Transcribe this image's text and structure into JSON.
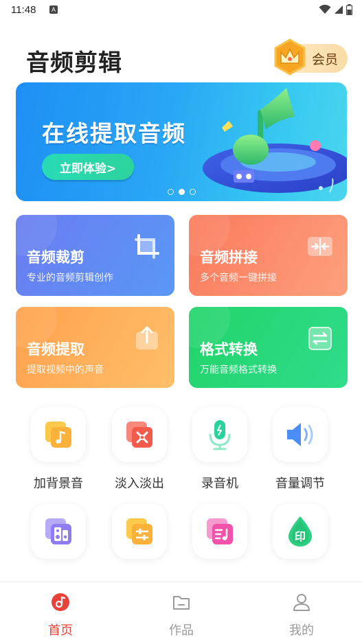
{
  "status_bar": {
    "time": "11:48",
    "notice_letter": "A"
  },
  "header": {
    "title": "音频剪辑",
    "vip_label": "会员"
  },
  "banner": {
    "title": "在线提取音频",
    "cta": "立即体验>",
    "active_dot": 1,
    "dot_count": 3
  },
  "cards": [
    {
      "title": "音频裁剪",
      "subtitle": "专业的音频剪辑创作",
      "icon": "crop-icon"
    },
    {
      "title": "音频拼接",
      "subtitle": "多个音频一键拼接",
      "icon": "merge-icon"
    },
    {
      "title": "音频提取",
      "subtitle": "提取视频中的声音",
      "icon": "upload-icon"
    },
    {
      "title": "格式转换",
      "subtitle": "万能音频格式转换",
      "icon": "convert-icon"
    }
  ],
  "tools": [
    {
      "label": "加背景音",
      "icon": "music-note-icon",
      "color": "#fbb23a"
    },
    {
      "label": "淡入淡出",
      "icon": "fade-icon",
      "color": "#f25a4c"
    },
    {
      "label": "录音机",
      "icon": "microphone-icon",
      "color": "#2ad39a"
    },
    {
      "label": "音量调节",
      "icon": "speaker-icon",
      "color": "#4a8df7"
    },
    {
      "label": "",
      "icon": "sound-box-icon",
      "color": "#8f7cf4"
    },
    {
      "label": "",
      "icon": "equalizer-icon",
      "color": "#fbb23a"
    },
    {
      "label": "",
      "icon": "playlist-icon",
      "color": "#f252a9"
    },
    {
      "label": "印",
      "icon": "watermark-drop-icon",
      "color": "#2dcf82"
    }
  ],
  "tabbar": {
    "items": [
      {
        "label": "首页",
        "icon": "home-music-icon",
        "active": true
      },
      {
        "label": "作品",
        "icon": "folder-icon",
        "active": false
      },
      {
        "label": "我的",
        "icon": "person-icon",
        "active": false
      }
    ]
  },
  "colors": {
    "accent": "#e8433a",
    "inactive": "#9a9a9a"
  }
}
